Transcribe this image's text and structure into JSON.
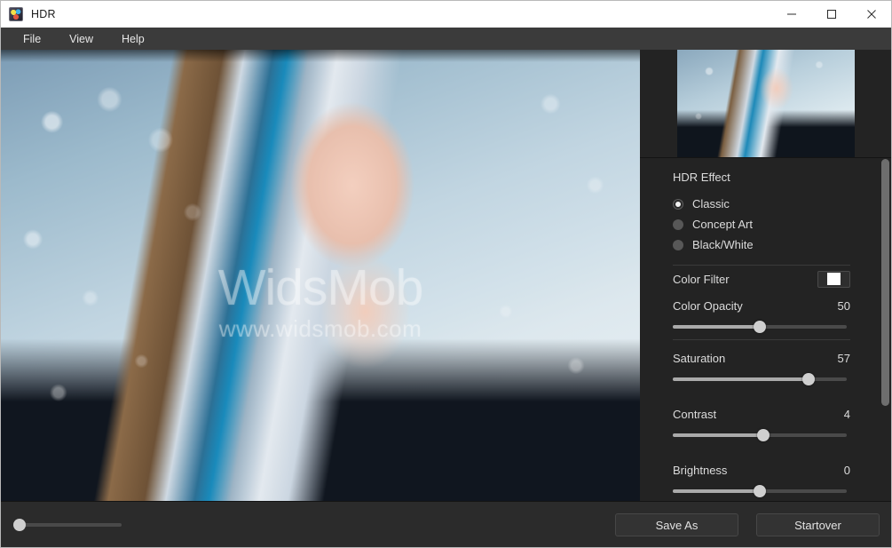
{
  "window": {
    "title": "HDR",
    "app_icon": "hdr-app-icon",
    "controls": [
      {
        "name": "minimize",
        "glyph": "minimize-icon"
      },
      {
        "name": "maximize",
        "glyph": "maximize-icon"
      },
      {
        "name": "close",
        "glyph": "close-icon"
      }
    ]
  },
  "menubar": {
    "items": [
      {
        "label": "File"
      },
      {
        "label": "View"
      },
      {
        "label": "Help"
      }
    ]
  },
  "preview": {
    "watermark_main": "WidsMob",
    "watermark_sub": "www.widsmob.com",
    "thumbnail_label": "preview-thumbnail"
  },
  "panel": {
    "hdr_effect": {
      "title": "HDR Effect",
      "options": [
        {
          "label": "Classic",
          "selected": true
        },
        {
          "label": "Concept Art",
          "selected": false
        },
        {
          "label": "Black/White",
          "selected": false
        }
      ]
    },
    "color_filter": {
      "label": "Color Filter",
      "swatch_color": "#ffffff"
    },
    "sliders": [
      {
        "label": "Color Opacity",
        "value": "50",
        "percent": 50
      },
      {
        "label": "Saturation",
        "value": "57",
        "percent": 78
      },
      {
        "label": "Contrast",
        "value": "4",
        "percent": 52
      },
      {
        "label": "Brightness",
        "value": "0",
        "percent": 50
      }
    ]
  },
  "bottombar": {
    "zoom_slider_percent": 0,
    "save_as_label": "Save As",
    "startover_label": "Startover"
  },
  "colors": {
    "titlebar_bg": "#ffffff",
    "menubar_bg": "#3b3b3b",
    "panel_bg": "#232323",
    "bottombar_bg": "#2b2b2b",
    "text": "#dcdcdc",
    "slider_fill": "#aaaaaa",
    "slider_track": "#4a4a4a"
  }
}
